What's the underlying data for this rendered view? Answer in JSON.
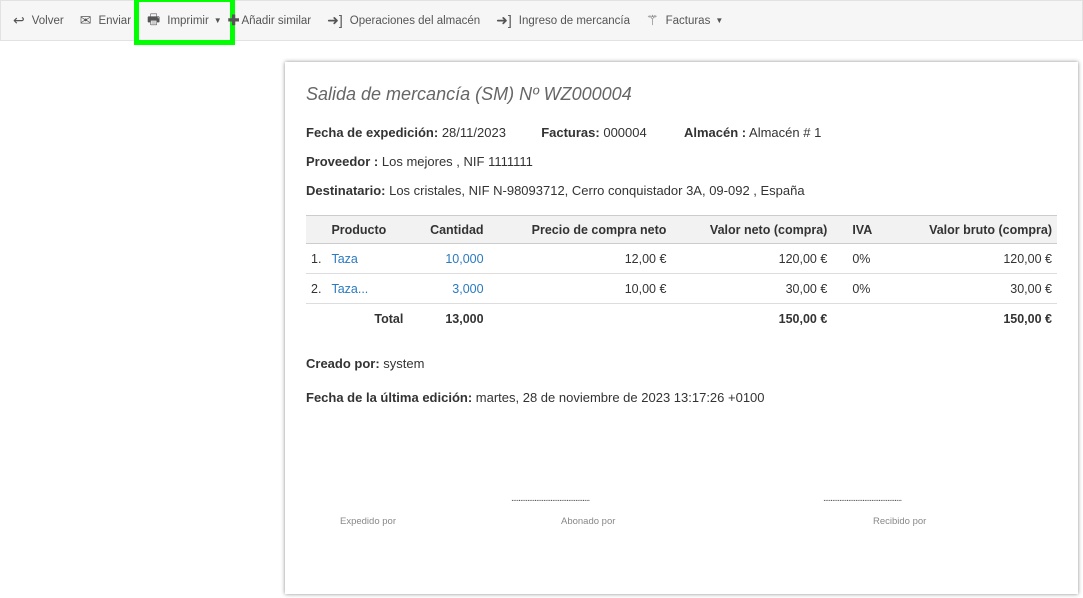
{
  "toolbar": {
    "back": "Volver",
    "send": "Enviar",
    "print": "Imprimir",
    "add_similar": "Añadir similar",
    "warehouse_ops": "Operaciones del almacén",
    "goods_receipt": "Ingreso de mercancía",
    "invoices": "Facturas"
  },
  "highlight_color": "#00ff00",
  "doc": {
    "title": "Salida de mercancía (SM) Nº WZ000004",
    "issue_date_label": "Fecha de expedición:",
    "issue_date": "28/11/2023",
    "invoices_label": "Facturas:",
    "invoices": "000004",
    "warehouse_label": "Almacén :",
    "warehouse": "Almacén # 1",
    "supplier_label": "Proveedor :",
    "supplier": "Los mejores , NIF 1111111",
    "recipient_label": "Destinatario:",
    "recipient": "Los cristales, NIF N-98093712, Cerro conquistador 3A, 09-092 , España",
    "columns": [
      "Producto",
      "Cantidad",
      "Precio de compra neto",
      "Valor neto (compra)",
      "IVA",
      "Valor bruto (compra)"
    ],
    "rows": [
      {
        "n": "1.",
        "product": "Taza",
        "qty": "10,000",
        "price": "12,00 €",
        "net": "120,00 €",
        "vat": "0%",
        "gross": "120,00 €"
      },
      {
        "n": "2.",
        "product": "Taza...",
        "qty": "3,000",
        "price": "10,00 €",
        "net": "30,00 €",
        "vat": "0%",
        "gross": "30,00 €"
      }
    ],
    "total": {
      "label": "Total",
      "qty": "13,000",
      "net": "150,00 €",
      "gross": "150,00 €"
    },
    "created_by_label": "Creado por:",
    "created_by": "system",
    "last_edit_label": "Fecha de la última edición:",
    "last_edit": "martes, 28 de noviembre de 2023 13:17:26 +0100",
    "sign_dots": "............................................",
    "sign": {
      "issued": "Expedido por",
      "paid": "Abonado por",
      "received": "Recibido por"
    }
  }
}
